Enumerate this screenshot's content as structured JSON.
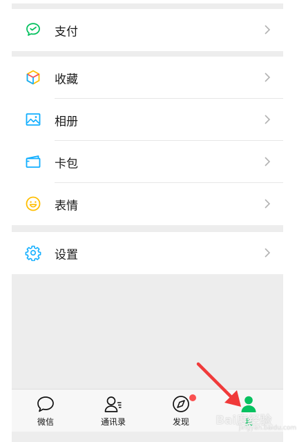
{
  "menu": {
    "pay": {
      "label": "支付"
    },
    "favorites": {
      "label": "收藏"
    },
    "album": {
      "label": "相册"
    },
    "cards": {
      "label": "卡包"
    },
    "stickers": {
      "label": "表情"
    },
    "settings": {
      "label": "设置"
    }
  },
  "tabbar": {
    "chats": {
      "label": "微信"
    },
    "contacts": {
      "label": "通讯录"
    },
    "discover": {
      "label": "发现"
    },
    "me": {
      "label": "我"
    }
  },
  "watermark": {
    "brand": "Bai度经验",
    "site": "jingyan.baidu.com"
  },
  "colors": {
    "accent": "#07c160",
    "badge": "#fa5151",
    "arrow": "#f03a3a"
  }
}
